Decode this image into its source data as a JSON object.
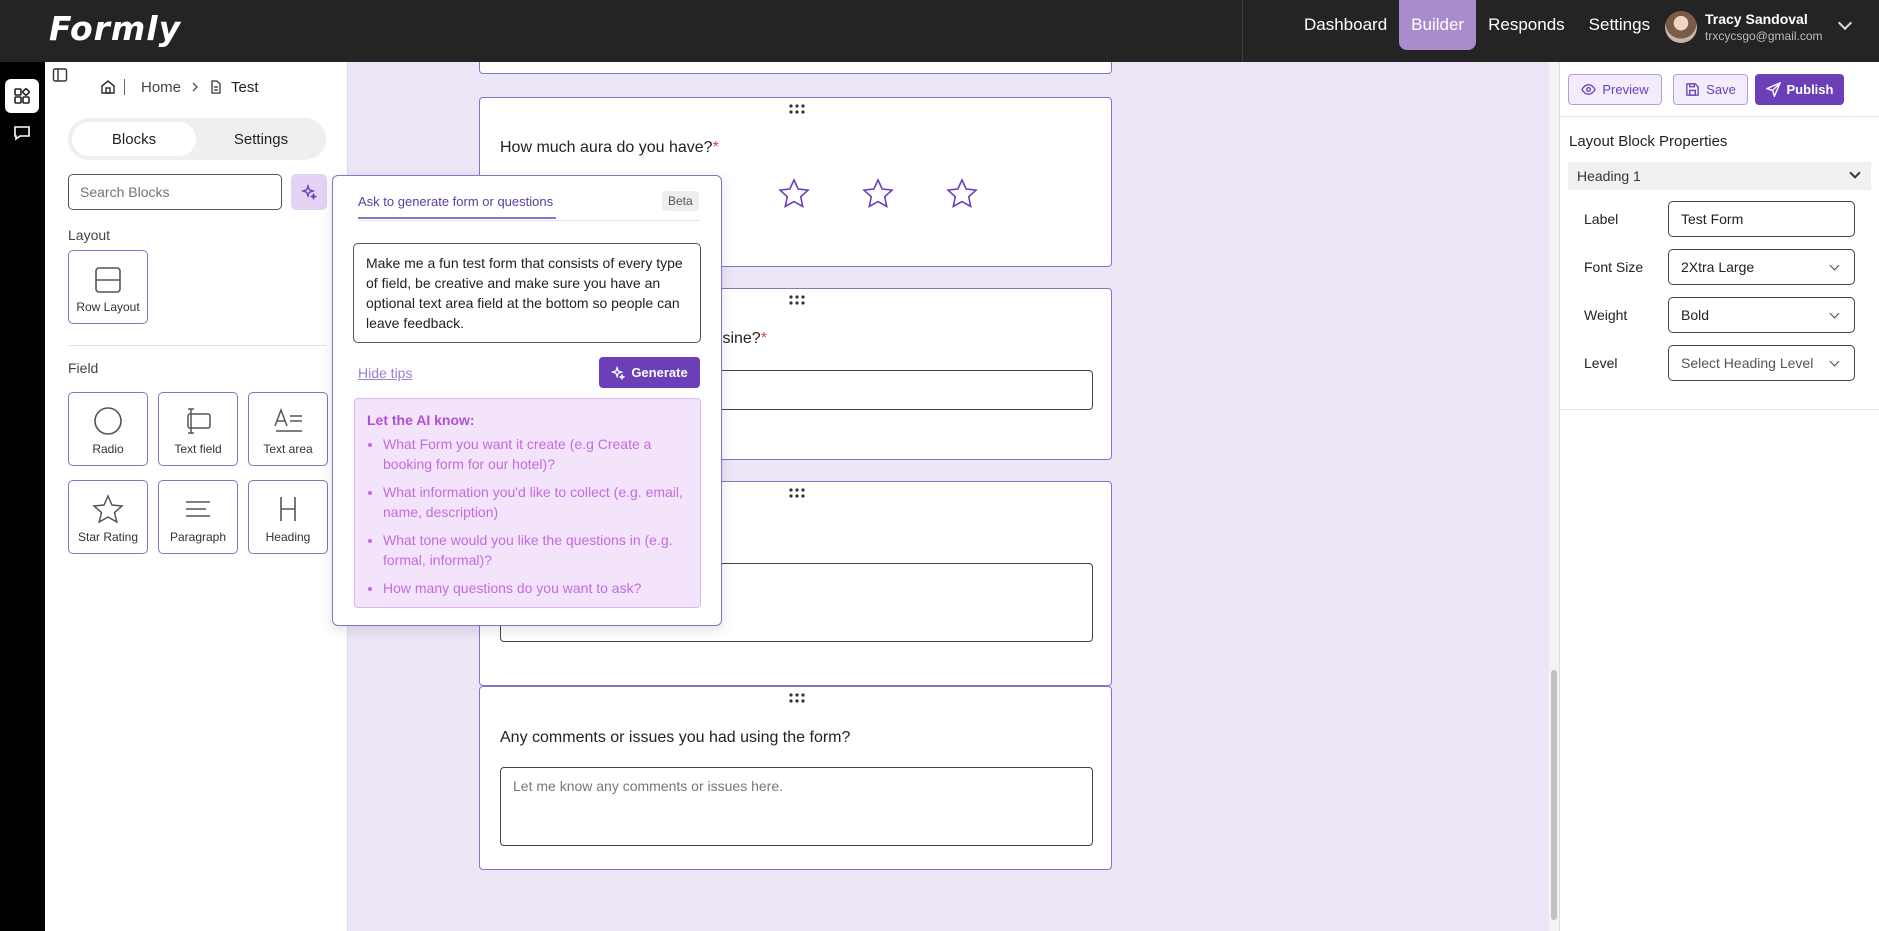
{
  "app": {
    "logo": "Formly"
  },
  "nav": {
    "items": [
      {
        "label": "Dashboard",
        "active": false
      },
      {
        "label": "Builder",
        "active": true
      },
      {
        "label": "Responds",
        "active": false
      },
      {
        "label": "Settings",
        "active": false
      }
    ]
  },
  "user": {
    "name": "Tracy Sandoval",
    "email": "trxcycsgo@gmail.com"
  },
  "breadcrumb": {
    "home": "Home",
    "current": "Test"
  },
  "left": {
    "tabs": [
      "Blocks",
      "Settings"
    ],
    "search_placeholder": "Search Blocks",
    "layout_label": "Layout",
    "field_label": "Field",
    "layout_blocks": [
      "Row Layout"
    ],
    "field_blocks": [
      "Radio",
      "Text field",
      "Text area",
      "Star Rating",
      "Paragraph",
      "Heading"
    ]
  },
  "canvas": {
    "q1": "How much aura do you have?",
    "q1_required": "*",
    "q2_fragment": "uisine?",
    "q2_required": "*",
    "q4": "Any comments or issues you had using the form?",
    "q4_placeholder": "Let me know any comments or issues here."
  },
  "ai": {
    "tab": "Ask to generate form or questions",
    "beta": "Beta",
    "prompt": "Make me a fun test form that consists of every type of field, be creative and make sure you have an optional text area field at the bottom so people can leave feedback.",
    "hide_tips": "Hide tips",
    "generate": "Generate",
    "tips_title": "Let the AI know:",
    "tips": [
      "What Form you want it create (e.g Create a booking form for our hotel)?",
      "What information you'd like to collect (e.g. email, name, description)",
      "What tone would you like the questions in (e.g. formal, informal)?",
      "How many questions do you want to ask?"
    ]
  },
  "right": {
    "preview": "Preview",
    "save": "Save",
    "publish": "Publish",
    "title": "Layout Block Properties",
    "section": "Heading 1",
    "props": [
      {
        "label": "Label",
        "value": "Test Form"
      },
      {
        "label": "Font Size",
        "value": "2Xtra Large"
      },
      {
        "label": "Weight",
        "value": "Bold"
      },
      {
        "label": "Level",
        "value": "Select Heading Level"
      }
    ]
  },
  "colors": {
    "accent": "#6a3fb8",
    "nav_active": "#a98ccc",
    "canvas_bg": "#ece6f7"
  }
}
